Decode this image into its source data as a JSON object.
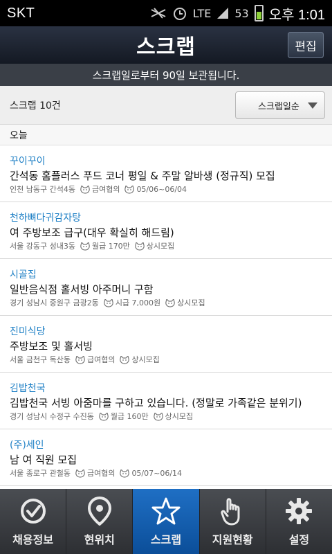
{
  "status": {
    "carrier": "SKT",
    "network": "LTE",
    "signal": "53",
    "time": "오후 1:01"
  },
  "header": {
    "title": "스크랩",
    "edit_label": "편집"
  },
  "notice": "스크랩일로부터 90일 보관됩니다.",
  "sortbar": {
    "count_label": "스크랩 10건",
    "sort_selected": "스크랩일순"
  },
  "section": "오늘",
  "items": [
    {
      "company": "꾸이꾸이",
      "title": "간석동 홈플러스 푸드 코너 평일 & 주말 알바생 (정규직) 모집",
      "location": "인천 남동구 간석4동",
      "pay": "급여협의",
      "period": "05/06~06/04"
    },
    {
      "company": "천하뼈다귀감자탕",
      "title": "여 주방보조 급구(대우 확실히 해드림)",
      "location": "서울 강동구 성내3동",
      "pay": "월급 170만",
      "period": "상시모집"
    },
    {
      "company": "시골집",
      "title": "일반음식점 홀서빙 아주머니 구함",
      "location": "경기 성남시 중원구 금광2동",
      "pay": "시급 7,000원",
      "period": "상시모집"
    },
    {
      "company": "진미식당",
      "title": "주방보조 및 홀서빙",
      "location": "서울 금천구 독산동",
      "pay": "급여협의",
      "period": "상시모집"
    },
    {
      "company": "김밥천국",
      "title": "김밥천국 서빙 아줌마를 구하고 있습니다. (정말로 가족같은 분위기)",
      "location": "경기 성남시 수정구 수진동",
      "pay": "월급 160만",
      "period": "상시모집"
    },
    {
      "company": "(주)세인",
      "title": "남 여 직원 모집",
      "location": "서울 종로구 관철동",
      "pay": "급여협의",
      "period": "05/07~06/14"
    }
  ],
  "tabs": [
    {
      "label": "채용정보",
      "icon": "check-circle-icon"
    },
    {
      "label": "현위치",
      "icon": "location-pin-icon"
    },
    {
      "label": "스크랩",
      "icon": "star-icon"
    },
    {
      "label": "지원현황",
      "icon": "hand-icon"
    },
    {
      "label": "설정",
      "icon": "gear-icon"
    }
  ],
  "colors": {
    "accent": "#1d7fc5",
    "tab_active": "#1565b8",
    "header_bg": "#1e2430"
  }
}
